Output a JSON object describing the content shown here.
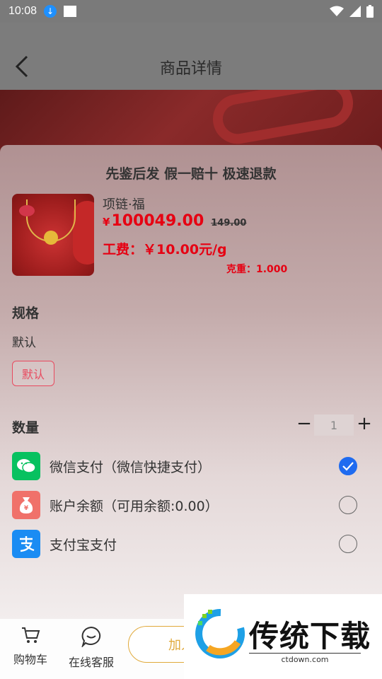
{
  "status_bar": {
    "time": "10:08"
  },
  "header": {
    "title": "商品详情"
  },
  "sheet": {
    "title": "先鉴后发 假一赔十 极速退款",
    "product": {
      "name": "项链·福",
      "currency": "¥",
      "price": "100049.00",
      "old_price": "149.00",
      "fee": "工费：￥10.00元/g",
      "weight": "克重：1.000"
    },
    "spec": {
      "heading": "规格",
      "value": "默认",
      "chip": "默认"
    },
    "quantity": {
      "heading": "数量",
      "minus": "−",
      "value": "1",
      "plus": "+"
    },
    "payments": [
      {
        "label": "微信支付（微信快捷支付）",
        "icon": "wechat-pay-icon",
        "color": "#07c160",
        "checked": true
      },
      {
        "label": "账户余额（可用余额:0.00）",
        "icon": "balance-icon",
        "color": "#f0716a",
        "checked": false
      },
      {
        "label": "支付宝支付",
        "icon": "alipay-icon",
        "color": "#1a8cf3",
        "checked": false
      }
    ]
  },
  "bottom_bar": {
    "cart_label": "购物车",
    "service_label": "在线客服",
    "add_cart_label": "加入"
  },
  "watermark": {
    "text": "传统下载",
    "url": "ctdown.com"
  },
  "colors": {
    "accent_red": "#e60012",
    "checked_blue": "#1f6bf0",
    "button_gold": "#e0a93a"
  }
}
